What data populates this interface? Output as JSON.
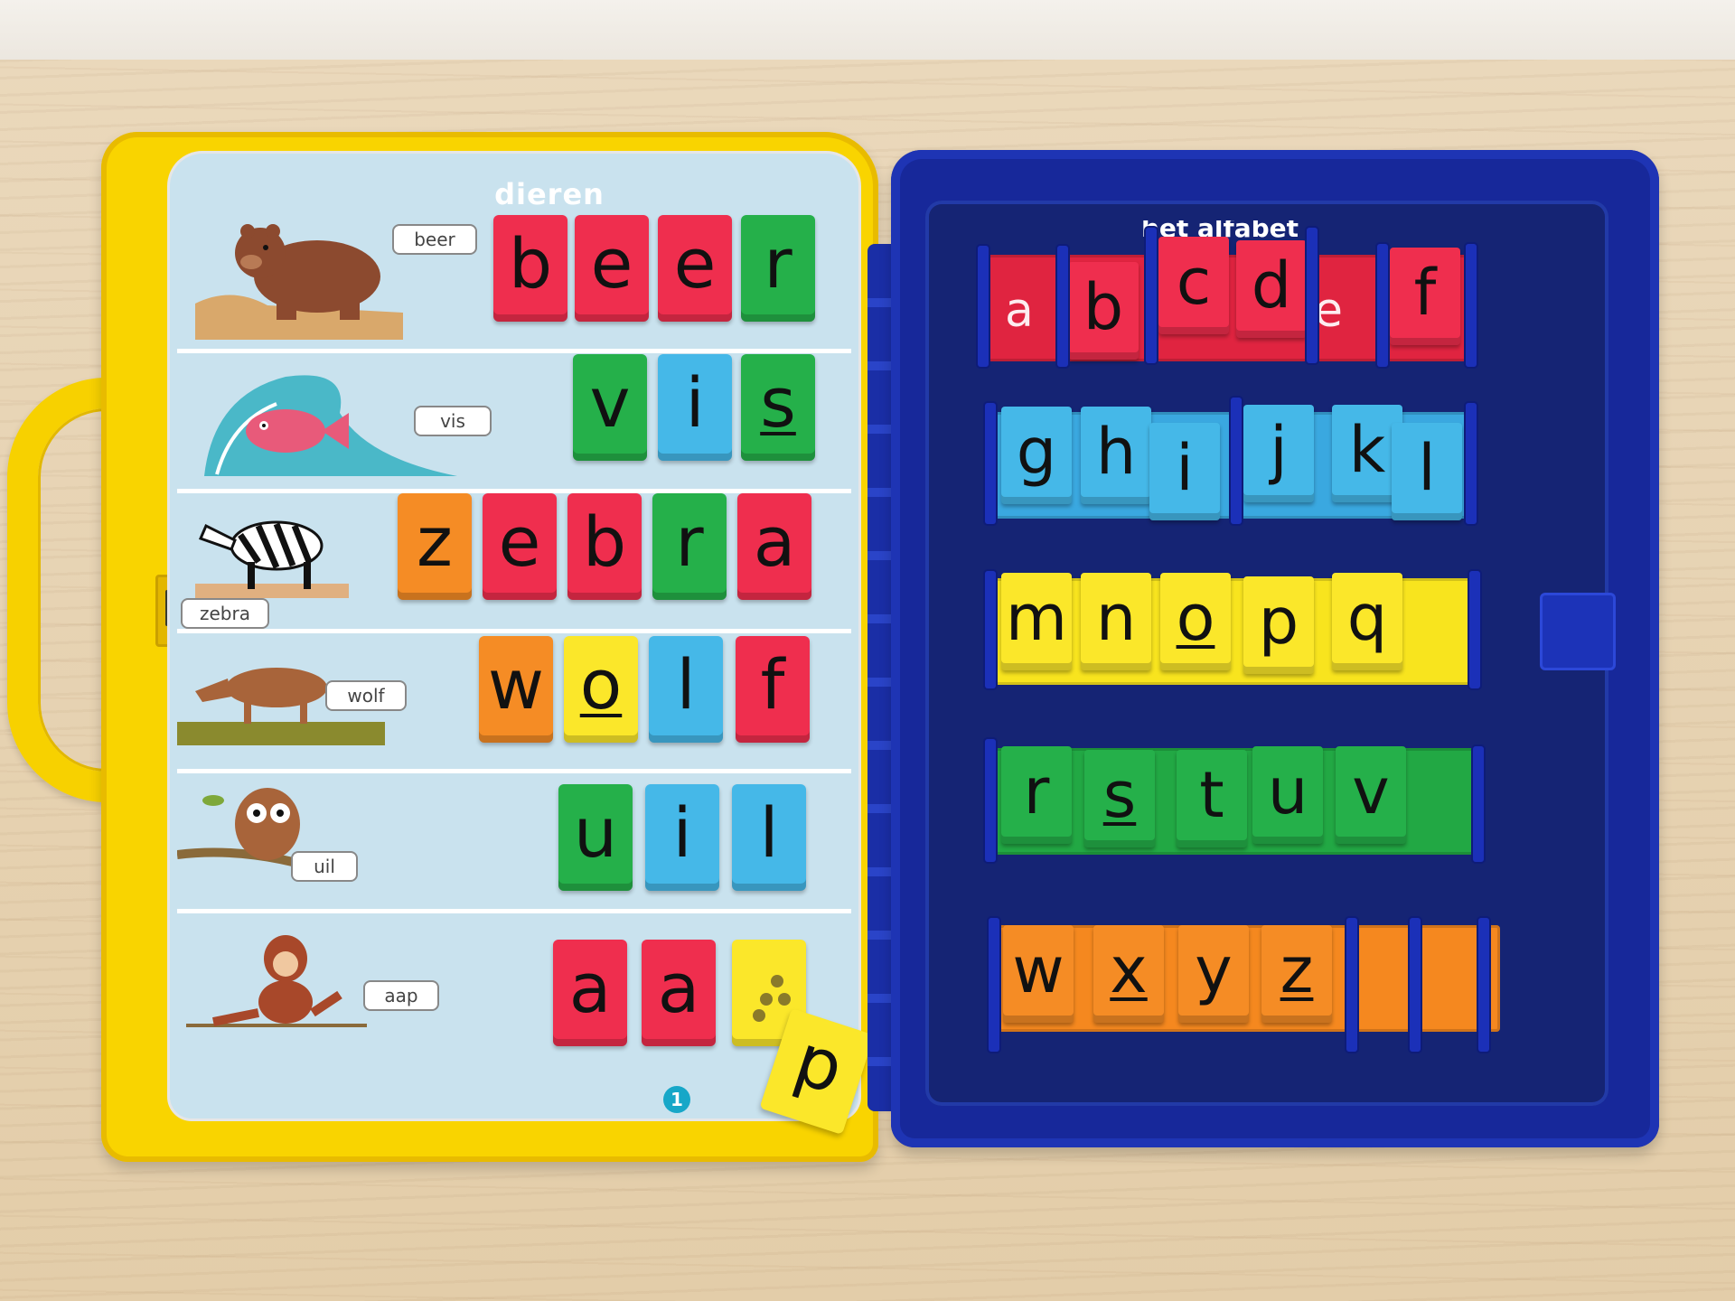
{
  "card": {
    "title": "dieren",
    "page_number": "1",
    "rows": [
      {
        "label": "beer",
        "letters": [
          "b",
          "e",
          "e",
          "r"
        ]
      },
      {
        "label": "vis",
        "letters": [
          "v",
          "i",
          "s"
        ]
      },
      {
        "label": "zebra",
        "letters": [
          "z",
          "e",
          "b",
          "r",
          "a"
        ]
      },
      {
        "label": "wolf",
        "letters": [
          "w",
          "o",
          "l",
          "f"
        ]
      },
      {
        "label": "uil",
        "letters": [
          "u",
          "i",
          "l"
        ]
      },
      {
        "label": "aap",
        "letters": [
          "a",
          "a"
        ]
      }
    ]
  },
  "loose_tile": "p",
  "alphabet_tray": {
    "title": "het alfabet",
    "rows": [
      {
        "tiles": [
          "b",
          "c",
          "d",
          "f"
        ],
        "ghosts": [
          "a",
          "e"
        ]
      },
      {
        "tiles": [
          "g",
          "h",
          "i",
          "j",
          "k",
          "l"
        ]
      },
      {
        "tiles": [
          "m",
          "n",
          "o",
          "p",
          "q"
        ]
      },
      {
        "tiles": [
          "r",
          "s",
          "t",
          "u",
          "v"
        ]
      },
      {
        "tiles": [
          "w",
          "x",
          "y",
          "z"
        ]
      }
    ]
  },
  "colors": {
    "red": "#ef2e4e",
    "green": "#25b04a",
    "blue": "#45b8e8",
    "yellow": "#fbe72a",
    "orange": "#f58c25",
    "case_yellow": "#f9d400",
    "case_blue": "#17289a"
  }
}
